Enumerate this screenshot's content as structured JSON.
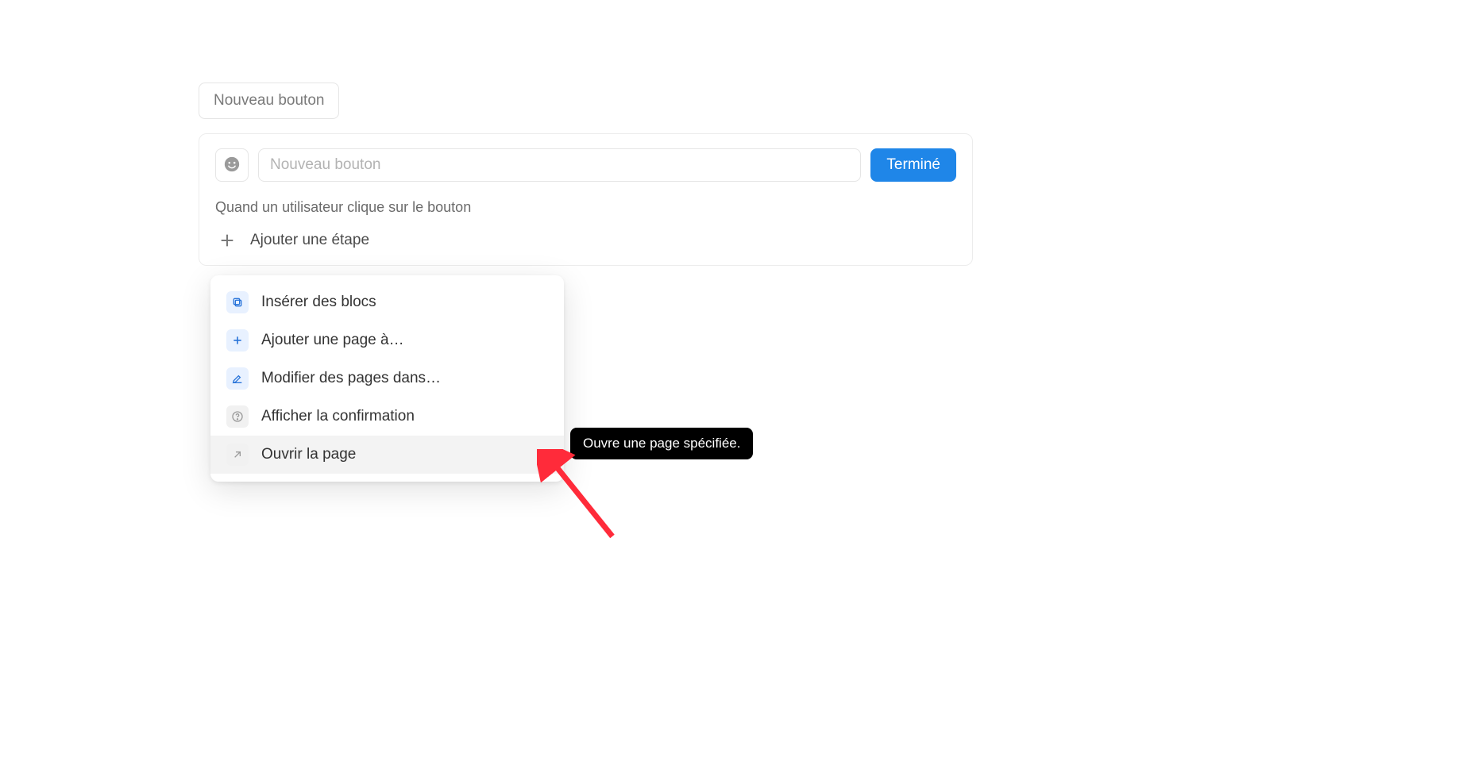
{
  "preview": {
    "label": "Nouveau bouton"
  },
  "editor": {
    "name_placeholder": "Nouveau bouton",
    "done_label": "Terminé",
    "section_label": "Quand un utilisateur clique sur le bouton",
    "add_step_label": "Ajouter une étape"
  },
  "menu": {
    "items": [
      {
        "label": "Insérer des blocs"
      },
      {
        "label": "Ajouter une page à…"
      },
      {
        "label": "Modifier des pages dans…"
      },
      {
        "label": "Afficher la confirmation"
      },
      {
        "label": "Ouvrir la page"
      }
    ]
  },
  "tooltip": {
    "text": "Ouvre une page spécifiée."
  }
}
